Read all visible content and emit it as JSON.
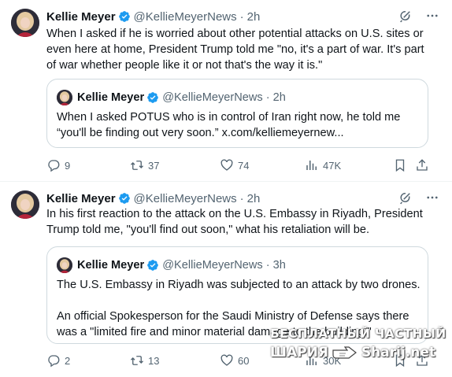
{
  "tweets": [
    {
      "author_name": "Kellie Meyer",
      "author_handle": "@KellieMeyerNews",
      "dot": "·",
      "time": "2h",
      "text": "When I asked if he is worried about other potential attacks on U.S. sites or\neven here at home, President Trump told me \"no, it's a part of war. It's part\nof war whether people like it or not that's the way it is.\"",
      "quote": {
        "author_name": "Kellie Meyer",
        "author_handle": "@KellieMeyerNews",
        "dot": "·",
        "time": "2h",
        "text": "When I asked POTUS who is in control of Iran right now, he told me\n“you'll be finding out very soon.” x.com/kelliemeyernew..."
      },
      "actions": {
        "replies": "9",
        "reposts": "37",
        "likes": "74",
        "views": "47K"
      }
    },
    {
      "author_name": "Kellie Meyer",
      "author_handle": "@KellieMeyerNews",
      "dot": "·",
      "time": "2h",
      "text": "In his first reaction to the attack on the U.S. Embassy in Riyadh, President\nTrump told me, \"you'll find out soon,\" what his retaliation will be.",
      "quote": {
        "author_name": "Kellie Meyer",
        "author_handle": "@KellieMeyerNews",
        "dot": "·",
        "time": "3h",
        "text": "The U.S. Embassy in Riyadh was subjected to an attack by two drones.\n\nAn official Spokesperson for the Saudi Ministry of Defense says there\nwas a \"limited fire and minor material damage to the building.\""
      },
      "actions": {
        "replies": "2",
        "reposts": "13",
        "likes": "60",
        "views": "30K"
      }
    }
  ],
  "icons": {
    "verified": "verified-badge-icon",
    "grok": "grok-icon",
    "more": "more-icon",
    "reply": "reply-icon",
    "repost": "repost-icon",
    "like": "heart-icon",
    "views": "views-icon",
    "bookmark": "bookmark-icon",
    "share": "share-icon"
  },
  "colors": {
    "verified_blue": "#1d9bf0",
    "text": "#0f1419",
    "secondary": "#536471",
    "border": "#cfd9de"
  },
  "watermark": {
    "line1": "БЕСПЛАТНЫЙ ЧАСТНЫЙ",
    "line2_left": "ШАРИЯ",
    "line2_right": "Sharij.net"
  }
}
